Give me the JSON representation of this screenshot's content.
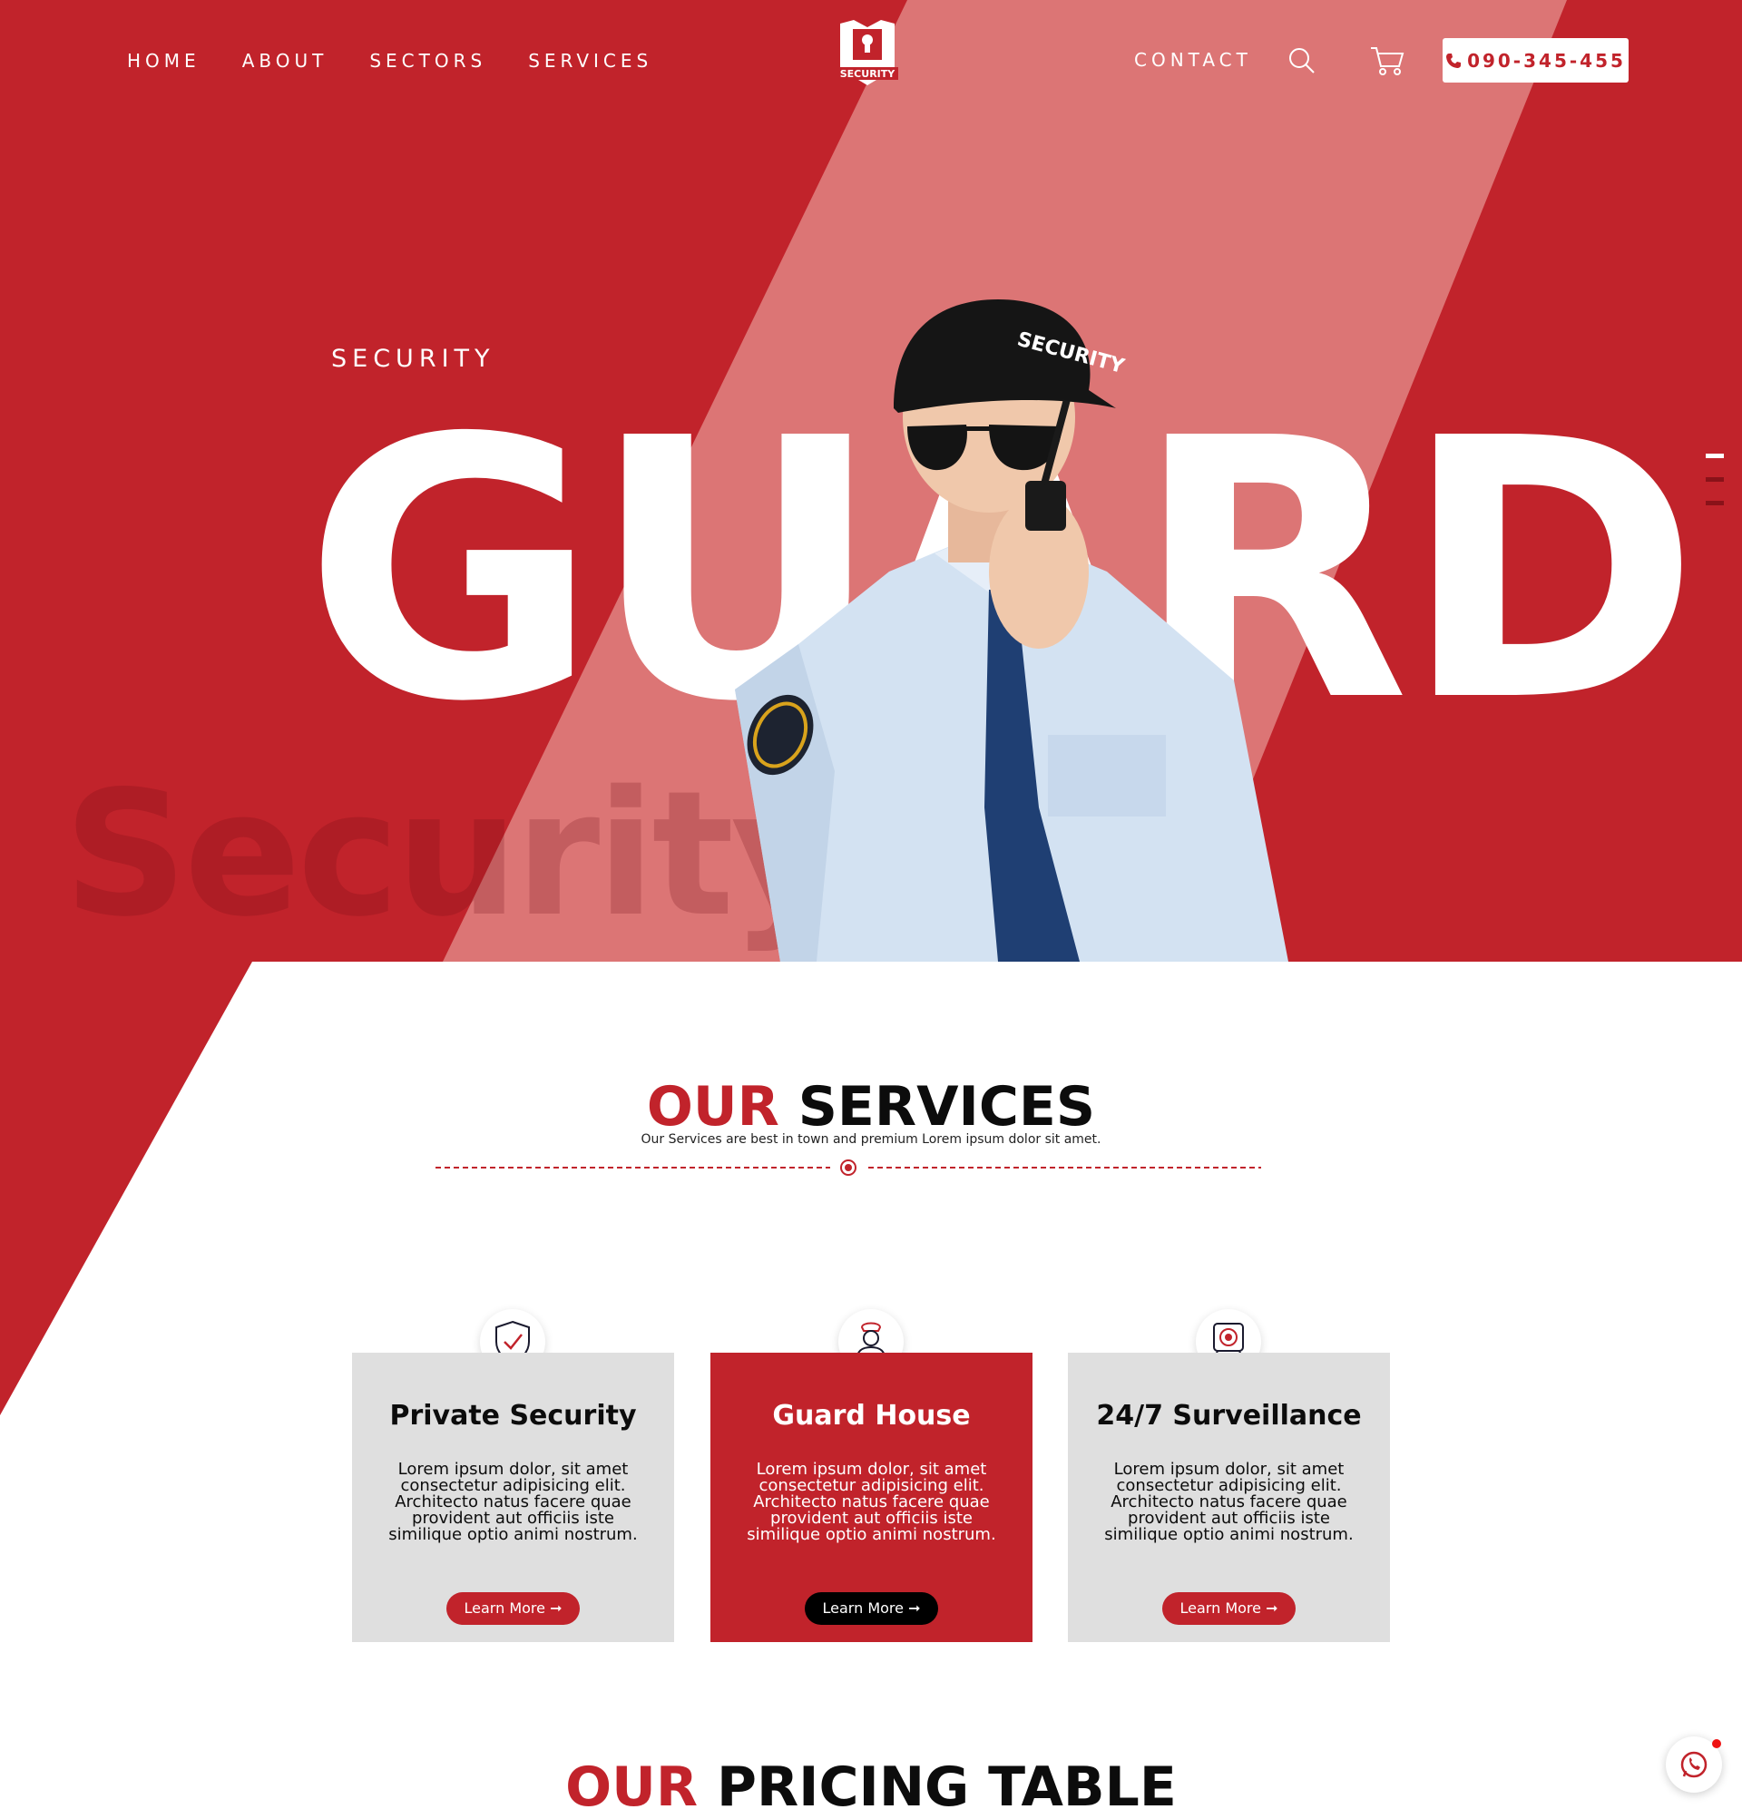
{
  "colors": {
    "brand_red": "#c1232b",
    "light_red": "#dc7575",
    "dark": "#0c0c0c",
    "card_gray": "#dfdfdf"
  },
  "logo": {
    "text": "SECURITY"
  },
  "nav": {
    "left": [
      "HOME",
      "ABOUT",
      "SECTORS",
      "SERVICES"
    ],
    "contact": "CONTACT",
    "phone": "090-345-455"
  },
  "icons": {
    "search": "search-icon",
    "cart": "cart-icon",
    "phone": "phone-icon",
    "chat": "whatsapp-icon"
  },
  "hero": {
    "kicker": "SECURITY",
    "title": "GUARD",
    "watermark": "Security",
    "guard_cap_text": "SECURITY"
  },
  "services": {
    "title_accent": "OUR",
    "title_rest": "SERVICES",
    "subtitle": "Our Services are best in town and premium Lorem ipsum dolor sit amet.",
    "cards": [
      {
        "icon": "shield-check-icon",
        "title": "Private Security",
        "text": "Lorem ipsum dolor, sit amet consectetur adipisicing elit. Architecto natus facere quae provident aut officiis iste similique optio animi nostrum.",
        "button": "Learn More"
      },
      {
        "icon": "guard-person-icon",
        "title": "Guard House",
        "text": "Lorem ipsum dolor, sit amet consectetur adipisicing elit. Architecto natus facere quae provident aut officiis iste similique optio animi nostrum.",
        "button": "Learn More"
      },
      {
        "icon": "webcam-icon",
        "title": "24/7 Surveillance",
        "text": "Lorem ipsum dolor, sit amet consectetur adipisicing elit. Architecto natus facere quae provident aut officiis iste similique optio animi nostrum.",
        "button": "Learn More"
      }
    ]
  },
  "pricing": {
    "title_accent": "OUR",
    "title_rest": "PRICING TABLE"
  }
}
